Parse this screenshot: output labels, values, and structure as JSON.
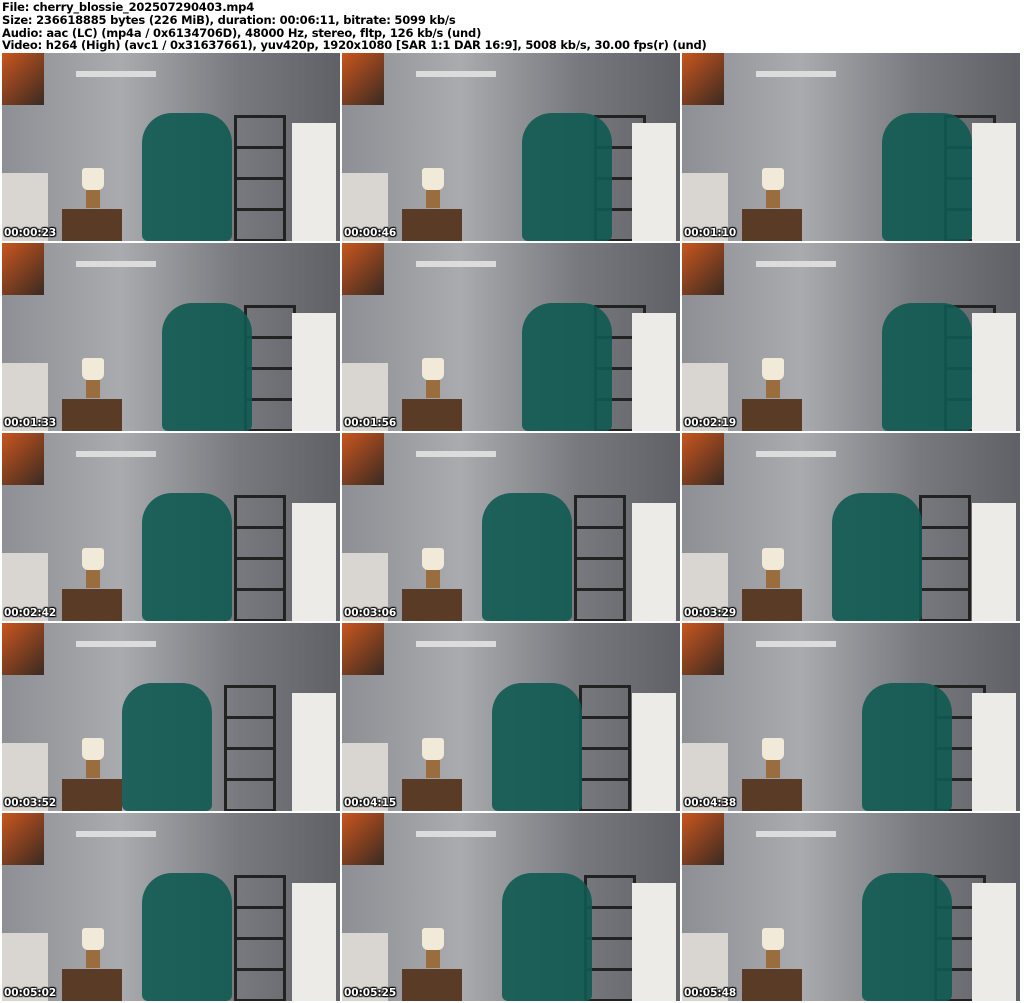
{
  "header": {
    "file": "File: cherry_blossie_202507290403.mp4",
    "size": "Size: 236618885 bytes (226 MiB), duration: 00:06:11, bitrate: 5099 kb/s",
    "audio": "Audio: aac (LC) (mp4a / 0x6134706D), 48000 Hz, stereo, fltp, 126 kb/s (und)",
    "video": "Video: h264 (High) (avc1 / 0x31637661), yuv420p, 1920x1080 [SAR 1:1 DAR 16:9], 5008 kb/s, 30.00 fps(r) (und)"
  },
  "thumbnails": [
    {
      "timestamp": "00:00:23"
    },
    {
      "timestamp": "00:00:46"
    },
    {
      "timestamp": "00:01:10"
    },
    {
      "timestamp": "00:01:33"
    },
    {
      "timestamp": "00:01:56"
    },
    {
      "timestamp": "00:02:19"
    },
    {
      "timestamp": "00:02:42"
    },
    {
      "timestamp": "00:03:06"
    },
    {
      "timestamp": "00:03:29"
    },
    {
      "timestamp": "00:03:52"
    },
    {
      "timestamp": "00:04:15"
    },
    {
      "timestamp": "00:04:38"
    },
    {
      "timestamp": "00:05:02"
    },
    {
      "timestamp": "00:05:25"
    },
    {
      "timestamp": "00:05:48"
    }
  ]
}
